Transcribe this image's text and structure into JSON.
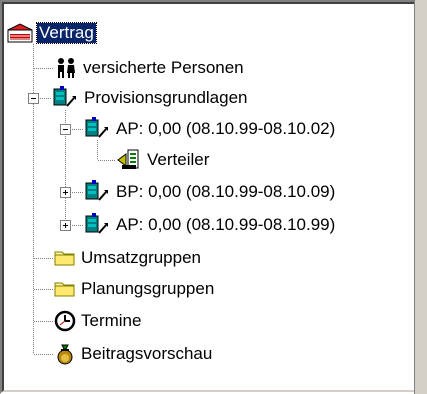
{
  "tree": {
    "root": {
      "label": "Vertrag",
      "icon": "contract-icon"
    },
    "items": [
      {
        "label": "versicherte Personen",
        "icon": "persons-icon"
      },
      {
        "label": "Provisionsgrundlagen",
        "icon": "commission-icon",
        "expanded": true
      },
      {
        "label": "AP: 0,00 (08.10.99-08.10.02)",
        "icon": "commission-icon",
        "expanded": true
      },
      {
        "label": "Verteiler",
        "icon": "distributor-icon"
      },
      {
        "label": "BP: 0,00 (08.10.99-08.10.09)",
        "icon": "commission-icon",
        "expanded": false
      },
      {
        "label": "AP: 0,00 (08.10.99-08.10.99)",
        "icon": "commission-icon",
        "expanded": false
      },
      {
        "label": "Umsatzgruppen",
        "icon": "folder-icon"
      },
      {
        "label": "Planungsgruppen",
        "icon": "folder-icon"
      },
      {
        "label": "Termine",
        "icon": "clock-icon"
      },
      {
        "label": "Beitragsvorschau",
        "icon": "money-bag-icon"
      }
    ]
  },
  "colors": {
    "selection": "#0a246a",
    "tree_lines": "#808080",
    "folder": "#fff3a0"
  }
}
